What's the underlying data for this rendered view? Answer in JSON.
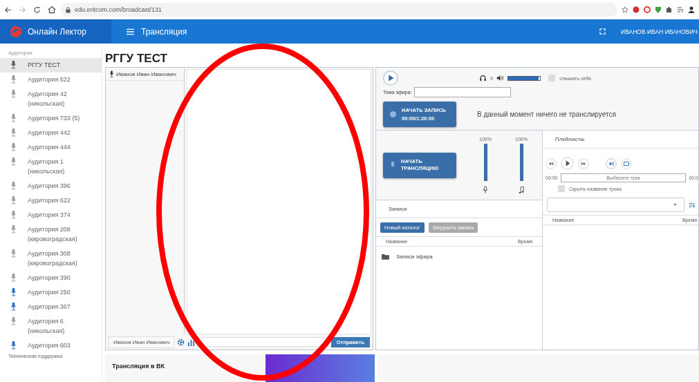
{
  "browser": {
    "url": "edu.eritcom.com/broadcast/131"
  },
  "header": {
    "brand": "Онлайн Лектор",
    "title": "Трансляция",
    "user": "ИВАНОВ ИВАН ИВАНОВИЧ"
  },
  "sidebar": {
    "label": "Аудитории",
    "items": [
      {
        "name": "РГГУ ТЕСТ",
        "selected": true,
        "live": false
      },
      {
        "name": "Аудитория 522",
        "selected": false,
        "live": false
      },
      {
        "name": "Аудитория 42 (никольская)",
        "selected": false,
        "live": false
      },
      {
        "name": "Аудитория 733 (5)",
        "selected": false,
        "live": false
      },
      {
        "name": "Аудитория 442",
        "selected": false,
        "live": false
      },
      {
        "name": "Аудитория 444",
        "selected": false,
        "live": false
      },
      {
        "name": "Аудитория 1 (никольская)",
        "selected": false,
        "live": false
      },
      {
        "name": "Аудитория 396",
        "selected": false,
        "live": false
      },
      {
        "name": "Аудитория 622",
        "selected": false,
        "live": false
      },
      {
        "name": "Аудитория 374",
        "selected": false,
        "live": false
      },
      {
        "name": "Аудитория 208 (кировоградская)",
        "selected": false,
        "live": false
      },
      {
        "name": "Аудитория 308 (кировоградская)",
        "selected": false,
        "live": false
      },
      {
        "name": "Аудитория 390",
        "selected": false,
        "live": false
      },
      {
        "name": "Аудитория 250",
        "selected": false,
        "live": true
      },
      {
        "name": "Аудитория 367",
        "selected": false,
        "live": true
      },
      {
        "name": "Аудитория 6 (никольская)",
        "selected": false,
        "live": false
      },
      {
        "name": "Аудитория 603",
        "selected": false,
        "live": true
      }
    ],
    "support": "Техническая поддержка"
  },
  "page_title": "РГГУ ТЕСТ",
  "chat": {
    "participants": [
      "Иванов Иван Иванович"
    ],
    "sender": "Иванов Иван Иванович",
    "send": "Отправить"
  },
  "below": {
    "heading": "Трансляция в ВК"
  },
  "broadcast": {
    "listeners": "0",
    "volume": {
      "level": 0.95
    },
    "hear_self": {
      "label": "слышать себя",
      "checked": false
    },
    "topic_label": "Тема эфира:",
    "record": {
      "label": "НАЧАТЬ ЗАПИСЬ",
      "time": "00:00/1:20:00"
    },
    "status": "В данный момент ничего не транслируется",
    "start": "НАЧАТЬ ТРАНСЛЯЦИЮ",
    "meters": [
      {
        "kind": "mic",
        "reading": "100%",
        "level": 1
      },
      {
        "kind": "music",
        "reading": "100%",
        "level": 1
      }
    ]
  },
  "records": {
    "tab": "Записи",
    "buttons": [
      {
        "label": "Новый каталог",
        "disabled": false
      },
      {
        "label": "Загрузить запись",
        "disabled": true
      }
    ],
    "columns": [
      "Название",
      "Время"
    ],
    "rows": [
      "Записи эфира"
    ]
  },
  "playlists": {
    "tab": "Плейлисты",
    "time_start": "00:00",
    "track_placeholder": "Выберите трек",
    "time_end": "00:0",
    "hide_name": {
      "label": "Скрыть название трека",
      "checked": false
    },
    "columns": [
      "Название",
      "Время"
    ]
  }
}
